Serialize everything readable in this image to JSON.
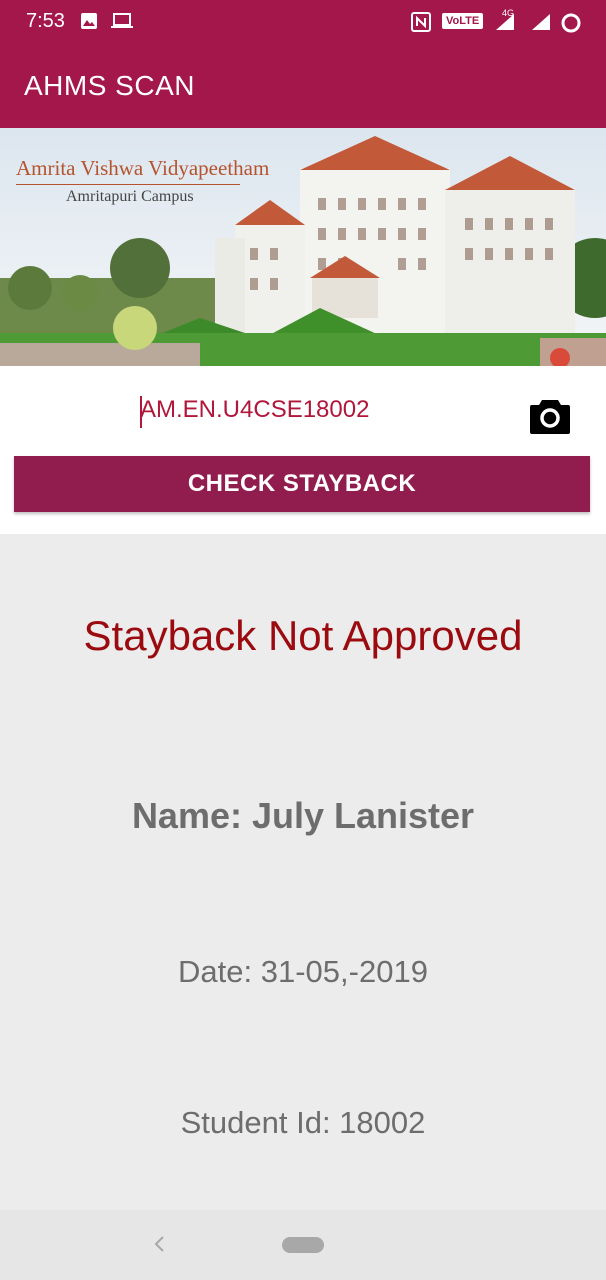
{
  "status_bar": {
    "time": "7:53",
    "volte_badge": "VoLTE",
    "network_label": "4G"
  },
  "app_bar": {
    "title": "AHMS SCAN",
    "color": "#a3174a"
  },
  "banner": {
    "title": "Amrita Vishwa Vidyapeetham",
    "subtitle": "Amritapuri Campus"
  },
  "form": {
    "student_id_value": "AM.EN.U4CSE18002",
    "camera_icon": "camera-icon",
    "check_button_label": "CHECK STAYBACK",
    "button_color": "#911d4f"
  },
  "result": {
    "status": "Stayback Not Approved",
    "name": "Name: July Lanister",
    "date": "Date: 31-05,-2019",
    "student_id": "Student Id: 18002",
    "status_color": "#9b0a0f"
  },
  "nav_bar": {
    "back_icon": "chevron-left-icon",
    "home_icon": "home-pill-icon"
  }
}
